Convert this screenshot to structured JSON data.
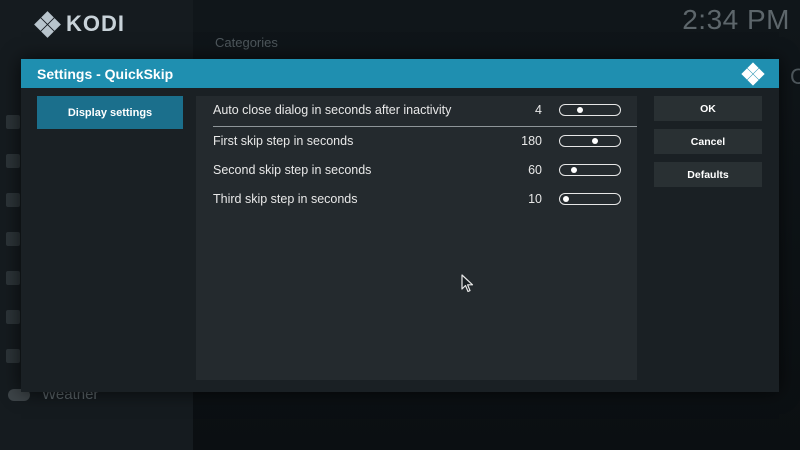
{
  "background": {
    "app_name": "KODI",
    "clock": "2:34 PM",
    "categories_label": "Categories",
    "weather_label": "Weather",
    "right_peek": "C"
  },
  "dialog": {
    "title": "Settings - QuickSkip",
    "header_color": "#1f8fb0",
    "categories": [
      {
        "label": "Display settings",
        "selected": true
      }
    ],
    "settings": [
      {
        "label": "Auto close dialog in seconds after inactivity",
        "value": "4",
        "slider_fraction": 0.3
      },
      {
        "label": "First skip step in seconds",
        "value": "180",
        "slider_fraction": 0.62
      },
      {
        "label": "Second skip step in seconds",
        "value": "60",
        "slider_fraction": 0.18
      },
      {
        "label": "Third skip step in seconds",
        "value": "10",
        "slider_fraction": 0.03
      }
    ],
    "buttons": {
      "ok": "OK",
      "cancel": "Cancel",
      "defaults": "Defaults"
    }
  },
  "icons": {
    "kodi_logo": "kodi-logo-icon",
    "dialog_logo": "kodi-logo-icon",
    "weather": "cloud-icon",
    "pointer": "mouse-pointer-icon"
  },
  "colors": {
    "accent": "#1f8fb0",
    "selected_category": "#1b6f8c",
    "panel": "#242a2e",
    "dialog_bg": "#1a2024"
  }
}
